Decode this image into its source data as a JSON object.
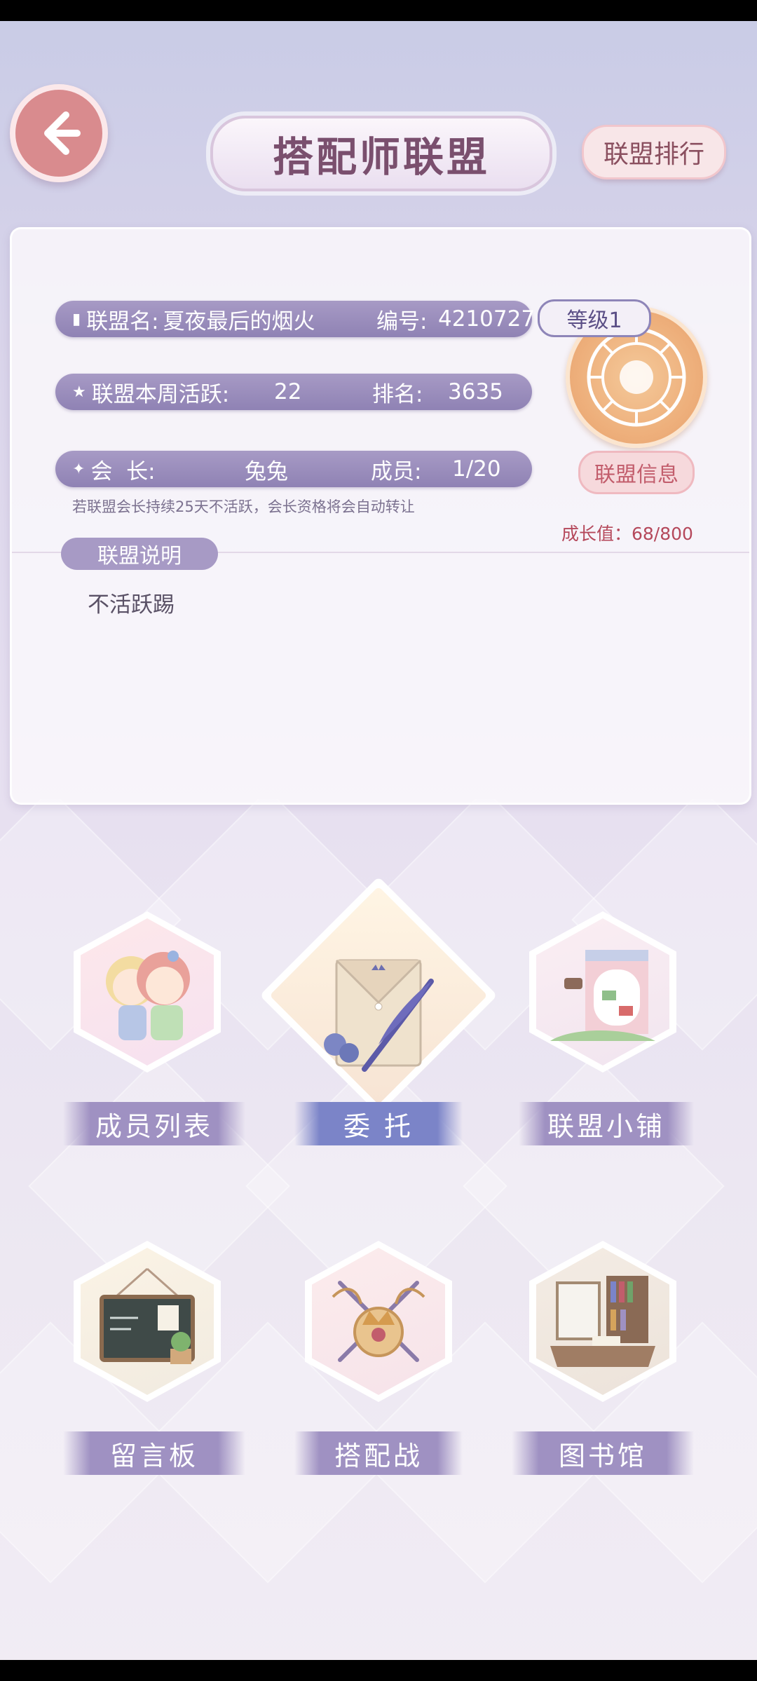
{
  "header": {
    "title": "搭配师联盟",
    "rank_button": "联盟排行"
  },
  "alliance": {
    "name_label": "联盟名:",
    "name": "夏夜最后的烟火",
    "id_label": "编号:",
    "id": "4210727",
    "weekly_activity_label": "联盟本周活跃:",
    "weekly_activity": "22",
    "rank_label": "排名:",
    "rank": "3635",
    "leader_label": "会  长:",
    "leader": "兔兔",
    "members_label": "成员:",
    "members": "1/20",
    "level": "等级1",
    "info_button": "联盟信息",
    "hint": "若联盟会长持续25天不活跃，会长资格将会自动转让",
    "growth": "成长值：68/800",
    "description_label": "联盟说明",
    "description": "不活跃踢"
  },
  "menu": {
    "members": "成员列表",
    "commission": "委  托",
    "shop": "联盟小铺",
    "board": "留言板",
    "battle": "搭配战",
    "library": "图书馆"
  },
  "colors": {
    "accent": "#9f91c2",
    "active": "#7b84c8",
    "back": "#d98b8e",
    "growth": "#b5485b"
  }
}
